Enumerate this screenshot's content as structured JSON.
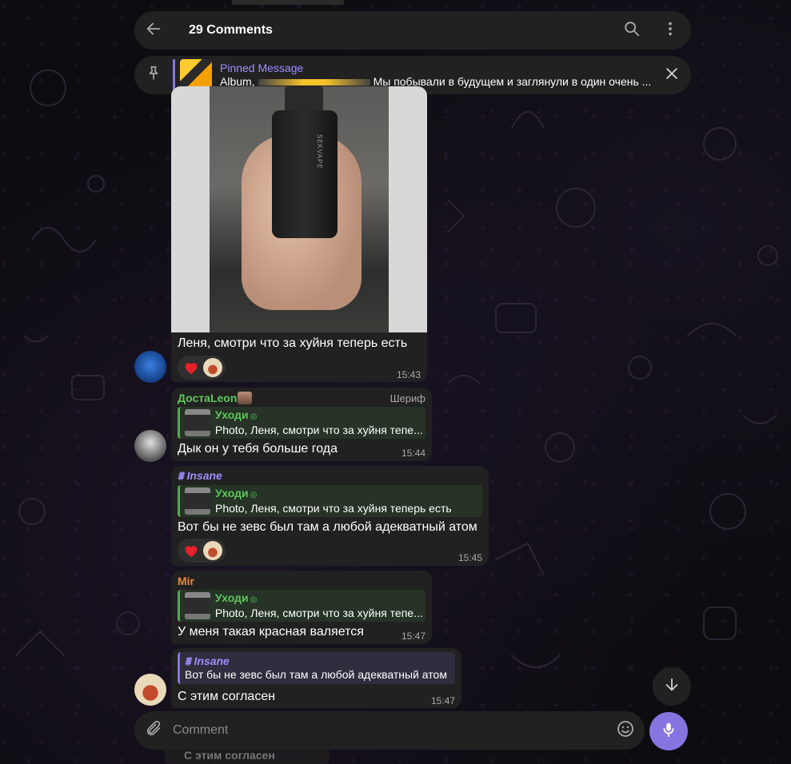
{
  "header": {
    "title": "29 Comments"
  },
  "pinned": {
    "label": "Pinned Message",
    "album_label": "Album,",
    "text": "Мы побывали в будущем и заглянули в один очень ..."
  },
  "messages": [
    {
      "text": "Леня, смотри что за хуйня теперь есть",
      "time": "15:43",
      "photo_label": "SEKVAPE"
    },
    {
      "sender": "ДостаLeon",
      "sender_color": "#5fc45d",
      "role": "Шериф",
      "reply_name": "Уходи",
      "reply_text": "Photo, Леня, смотри что за хуйня тепе...",
      "text": "Дык он у тебя больше года",
      "time": "15:44"
    },
    {
      "sender": "Insane",
      "sender_color": "#a08dff",
      "reply_name": "Уходи",
      "reply_text": "Photo, Леня, смотри что за хуйня теперь есть",
      "text": "Вот бы не зевс был там а любой адекватный атом",
      "time": "15:45"
    },
    {
      "sender": "Mir",
      "sender_color": "#e88b3a",
      "reply_name": "Уходи",
      "reply_text": "Photo, Леня, смотри что за хуйня тепе...",
      "text": "У меня такая красная валяется",
      "time": "15:47"
    },
    {
      "reply_name": "Insane",
      "reply_text": "Вот бы не зевс был там а любой адекватный атом",
      "text": "С этим согласен",
      "time": "15:47"
    }
  ],
  "composer": {
    "placeholder": "Comment"
  },
  "ghost_text": "С этим согласен",
  "colors": {
    "accent": "#8774e1",
    "bubble": "#212121",
    "reply_green": "#4fae4e"
  }
}
